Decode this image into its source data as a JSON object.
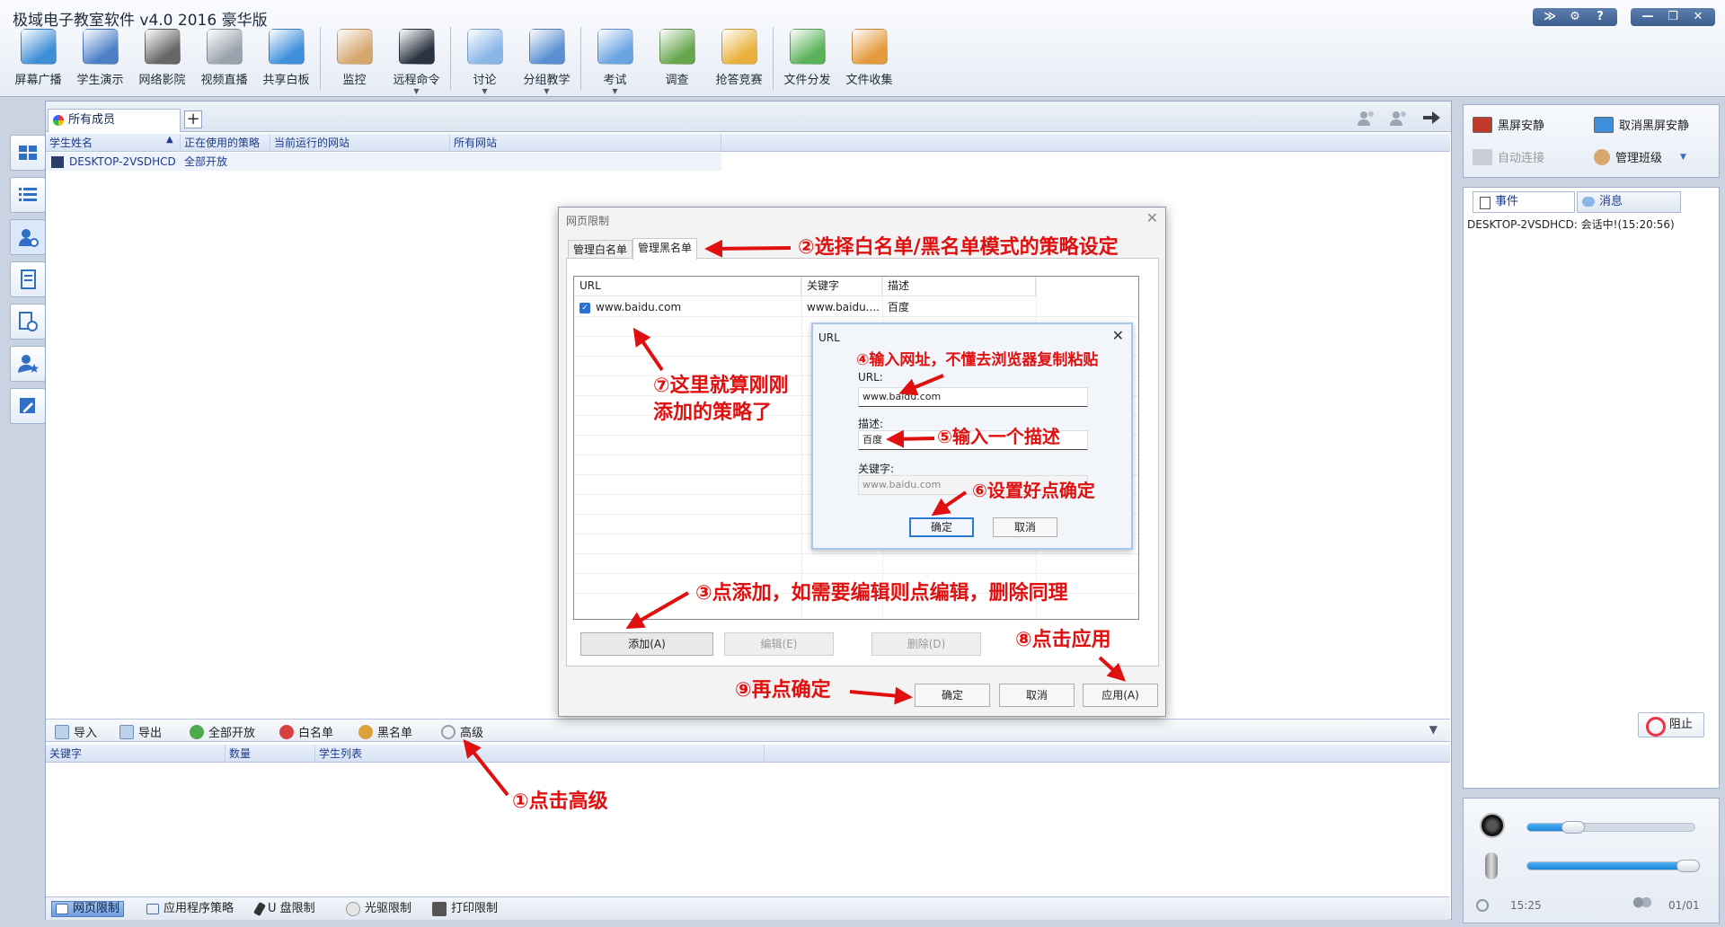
{
  "app": {
    "title": "极域电子教室软件 v4.0 2016 豪华版"
  },
  "window_buttons": [
    "≫",
    "⚙",
    "?",
    "—",
    "❐",
    "✕"
  ],
  "toolbar": [
    {
      "label": "屏幕广播",
      "icon": "screen-broadcast-icon",
      "color": "#3f8fd6"
    },
    {
      "label": "学生演示",
      "icon": "student-demo-icon",
      "color": "#4d7fc7"
    },
    {
      "label": "网络影院",
      "icon": "film-reel-icon",
      "color": "#666666"
    },
    {
      "label": "视频直播",
      "icon": "webcam-icon",
      "color": "#9aa3ad"
    },
    {
      "label": "共享白板",
      "icon": "whiteboard-icon",
      "color": "#3e8fdc"
    },
    {
      "label": "监控",
      "icon": "monitor-person-icon",
      "color": "#d7a770"
    },
    {
      "label": "远程命令",
      "icon": "command-icon",
      "color": "#2a3340",
      "caret": true
    },
    {
      "label": "讨论",
      "icon": "chat-bubble-icon",
      "color": "#8ab6e6",
      "caret": true
    },
    {
      "label": "分组教学",
      "icon": "group-icon",
      "color": "#5a8fd1",
      "caret": true
    },
    {
      "label": "考试",
      "icon": "exam-icon",
      "color": "#6ba4e2",
      "caret": true
    },
    {
      "label": "调查",
      "icon": "survey-icon",
      "color": "#68a64e"
    },
    {
      "label": "抢答竞赛",
      "icon": "quiz-star-icon",
      "color": "#e9b13b"
    },
    {
      "label": "文件分发",
      "icon": "file-send-icon",
      "color": "#59b25a"
    },
    {
      "label": "文件收集",
      "icon": "file-collect-icon",
      "color": "#e39a3b"
    }
  ],
  "main": {
    "tab_label": "所有成员",
    "tab_add": "+",
    "columns": [
      "学生姓名",
      "正在使用的策略",
      "当前运行的网站",
      "所有网站"
    ],
    "rows": [
      {
        "name": "DESKTOP-2VSDHCD",
        "policy": "全部开放"
      }
    ],
    "bottom_toolbar": [
      "导入",
      "导出",
      "全部开放",
      "白名单",
      "黑名单",
      "高级"
    ],
    "columns2": [
      "关键字",
      "数量",
      "学生列表"
    ],
    "policy_tabs": [
      "网页限制",
      "应用程序策略",
      "U 盘限制",
      "光驱限制",
      "打印限制"
    ]
  },
  "right": {
    "actions": [
      "黑屏安静",
      "取消黑屏安静",
      "自动连接",
      "管理班级"
    ],
    "tabs": [
      "事件",
      "消息"
    ],
    "event_line": "DESKTOP-2VSDHCD: 会话中!(15:20:56)",
    "block_label": "阻止",
    "speaker_level": 0.28,
    "mic_level": 0.97,
    "time": "15:25",
    "count": "01/01"
  },
  "dialog": {
    "title": "网页限制",
    "tabs": [
      "管理白名单",
      "管理黑名单"
    ],
    "list_headers": [
      "URL",
      "关键字",
      "描述"
    ],
    "list_rows": [
      {
        "url": "www.baidu.com",
        "keyword": "www.baidu....",
        "desc": "百度"
      }
    ],
    "buttons": {
      "add": "添加(A)",
      "edit": "编辑(E)",
      "delete": "删除(D)",
      "ok": "确定",
      "cancel": "取消",
      "apply": "应用(A)"
    }
  },
  "subdialog": {
    "title": "URL",
    "url_label": "URL:",
    "url_value": "www.baidu.com",
    "desc_label": "描述:",
    "desc_value": "百度",
    "kw_label": "关键字:",
    "kw_value": "www.baidu.com",
    "ok": "确定",
    "cancel": "取消"
  },
  "annotations": {
    "a1": "①点击高级",
    "a2": "②选择白名单/黑名单模式的策略设定",
    "a3": "③点添加，如需要编辑则点编辑，删除同理",
    "a4": "④输入网址，不懂去浏览器复制粘贴",
    "a5": "⑤输入一个描述",
    "a6": "⑥设置好点确定",
    "a7a": "⑦这里就算刚刚",
    "a7b": "添加的策略了",
    "a8": "⑧点击应用",
    "a9": "⑨再点确定"
  },
  "colors": {
    "annotation": "#e01010",
    "accent": "#2b7bd6"
  }
}
